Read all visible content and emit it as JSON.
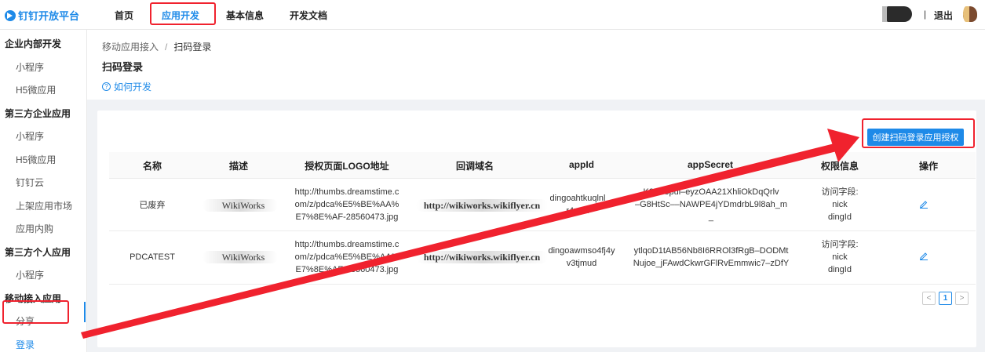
{
  "brand": {
    "name": "钉钉开放平台"
  },
  "topnav": {
    "items": [
      "首页",
      "应用开发",
      "基本信息",
      "开发文档"
    ],
    "active_index": 1,
    "separator": "|",
    "logout": "退出"
  },
  "sidebar": {
    "entries": [
      {
        "label": "企业内部开发",
        "type": "group"
      },
      {
        "label": "小程序",
        "type": "item"
      },
      {
        "label": "H5微应用",
        "type": "item"
      },
      {
        "label": "第三方企业应用",
        "type": "group"
      },
      {
        "label": "小程序",
        "type": "item"
      },
      {
        "label": "H5微应用",
        "type": "item"
      },
      {
        "label": "钉钉云",
        "type": "item"
      },
      {
        "label": "上架应用市场",
        "type": "item"
      },
      {
        "label": "应用内购",
        "type": "item"
      },
      {
        "label": "第三方个人应用",
        "type": "group"
      },
      {
        "label": "小程序",
        "type": "item"
      },
      {
        "label": "移动接入应用",
        "type": "group"
      },
      {
        "label": "分享",
        "type": "item"
      },
      {
        "label": "登录",
        "type": "item",
        "active": true
      }
    ]
  },
  "breadcrumb": {
    "parent": "移动应用接入",
    "separator": "/",
    "current": "扫码登录"
  },
  "page": {
    "title": "扫码登录",
    "help_icon": "?",
    "help_link": "如何开发"
  },
  "actions": {
    "create_label": "创建扫码登录应用授权"
  },
  "table": {
    "headers": [
      "名称",
      "描述",
      "授权页面LOGO地址",
      "回调域名",
      "appId",
      "appSecret",
      "权限信息",
      "操作"
    ],
    "rows": [
      {
        "name": "已废弃",
        "desc": "WikiWorks",
        "logo_lines": [
          "http://thumbs.dreamstime.c",
          "om/z/pdca%E5%BE%AA%",
          "E7%8E%AF-28560473.jpg"
        ],
        "domain": "http://wikiworks.wikiflyer.cn",
        "appid_lines": [
          "dingoahtkuqlnl",
          "r4wsu"
        ],
        "secret_lines": [
          "K2Y88pul–eyzOAA21XhliOkDqQrlv",
          "–G8HtSc––NAWPE4jYDmdrbL9l8ah_m",
          "_"
        ],
        "perm_label": "访问字段:",
        "perm_lines": [
          "nick",
          "dingId"
        ]
      },
      {
        "name": "PDCATEST",
        "desc": "WikiWorks",
        "logo_lines": [
          "http://thumbs.dreamstime.c",
          "om/z/pdca%E5%BE%AA%",
          "E7%8E%AF-28560473.jpg"
        ],
        "domain": "http://wikiworks.wikiflyer.cn",
        "appid_lines": [
          "dingoawmso4fj4y",
          "v3tjmud"
        ],
        "secret_lines": [
          "ytlqoD1tAB56Nb8I6RROl3fRgB–DODMt",
          "Nujoe_jFAwdCkwrGFlRvEmmwic7–zDfY"
        ],
        "perm_label": "访问字段:",
        "perm_lines": [
          "nick",
          "dingId"
        ]
      }
    ]
  },
  "pagination": {
    "prev": "<",
    "current": "1",
    "next": ">"
  },
  "colors": {
    "accent": "#1e8ae8",
    "annotation": "#f0222e",
    "background": "#f0f2f5"
  },
  "icons": {
    "edit": "pencil-icon",
    "help": "question-circle-icon",
    "brand": "dingtalk-logo-icon"
  }
}
